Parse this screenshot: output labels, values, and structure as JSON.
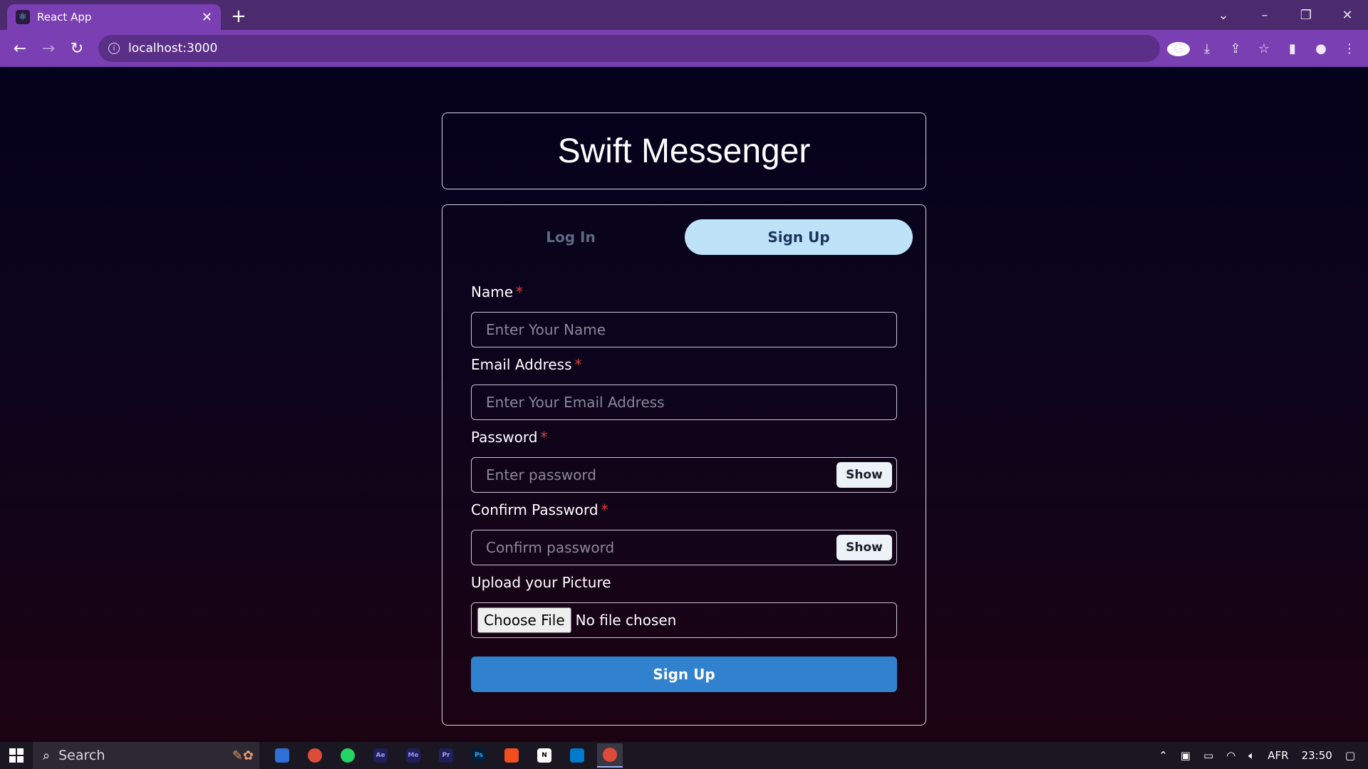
{
  "browser": {
    "tab_title": "React App",
    "url": "localhost:3000",
    "icons": [
      "react-logo-icon",
      "close-icon",
      "plus-icon",
      "chevron-down-icon",
      "minimize-icon",
      "restore-icon",
      "window-close-icon",
      "back-icon",
      "forward-icon",
      "reload-icon",
      "info-icon",
      "google-icon",
      "install-icon",
      "share-icon",
      "star-icon",
      "sidepanel-icon",
      "profile-icon",
      "menu-icon"
    ]
  },
  "app": {
    "title": "Swift Messenger",
    "tabs": {
      "login": "Log In",
      "signup": "Sign Up",
      "active": "signup"
    },
    "fields": {
      "name": {
        "label": "Name",
        "required": "*",
        "placeholder": "Enter Your Name"
      },
      "email": {
        "label": "Email Address",
        "required": "*",
        "placeholder": "Enter Your Email Address"
      },
      "password": {
        "label": "Password",
        "required": "*",
        "placeholder": "Enter password",
        "toggle": "Show"
      },
      "confirm": {
        "label": "Confirm Password",
        "required": "*",
        "placeholder": "Confirm password",
        "toggle": "Show"
      },
      "picture": {
        "label": "Upload your Picture",
        "button": "Choose File",
        "status": "No file chosen"
      }
    },
    "submit": "Sign Up",
    "colors": {
      "accent": "#3182ce",
      "active_tab": "#bee3f8",
      "required": "#e53e3e"
    }
  },
  "taskbar": {
    "search": "Search",
    "language": "AFR",
    "time": "23:50",
    "apps": [
      {
        "abbr": "",
        "color": "#2f6fd6"
      },
      {
        "abbr": "",
        "color": "#dd4b39"
      },
      {
        "abbr": "",
        "color": "#25d366"
      },
      {
        "abbr": "Ae",
        "color": "#1f1e57"
      },
      {
        "abbr": "Me",
        "color": "#1f1e57"
      },
      {
        "abbr": "Pr",
        "color": "#1f1e57"
      },
      {
        "abbr": "Ps",
        "color": "#001e36"
      },
      {
        "abbr": "",
        "color": "#f24e1e"
      },
      {
        "abbr": "N",
        "color": "#ffffff"
      },
      {
        "abbr": "",
        "color": "#007acc"
      },
      {
        "abbr": "",
        "color": "#dd4b39"
      }
    ]
  }
}
